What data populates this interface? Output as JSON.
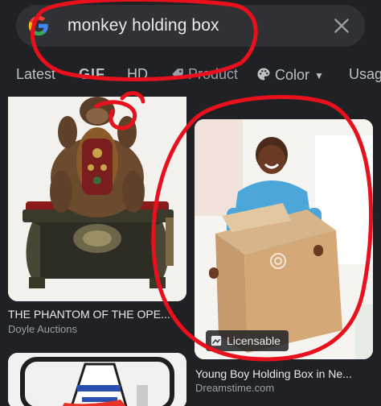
{
  "search": {
    "query": "monkey holding box",
    "icon": "google-g-icon",
    "clear_icon": "close-icon"
  },
  "chips": [
    {
      "label": "Latest"
    },
    {
      "label": "GIF"
    },
    {
      "label": "HD"
    },
    {
      "label": "Product",
      "icon": "tag-icon"
    },
    {
      "label": "Color",
      "icon": "palette-icon"
    },
    {
      "label": "Usag"
    }
  ],
  "results": [
    {
      "title": "THE PHANTOM OF THE OPE...",
      "source": "Doyle Auctions"
    },
    {
      "title": "Young Boy Holding Box in Ne...",
      "source": "Dreamstime.com",
      "badge": "Licensable"
    },
    {
      "title": "",
      "source": ""
    }
  ],
  "colors": {
    "background": "#202124",
    "annotation_red": "#e8101c"
  }
}
